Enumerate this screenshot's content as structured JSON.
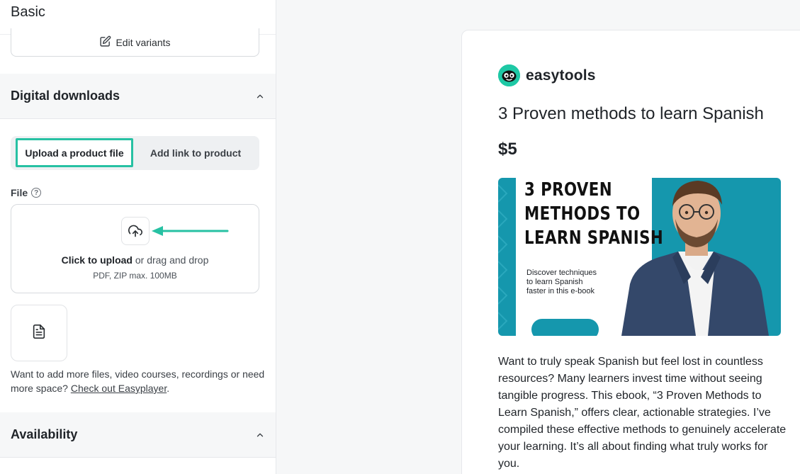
{
  "left": {
    "basic_title": "Basic",
    "edit_variants_label": "Edit variants",
    "digital_downloads_title": "Digital downloads",
    "tabs": {
      "upload": "Upload a product file",
      "link": "Add link to product"
    },
    "file_label": "File",
    "help_glyph": "?",
    "dropzone": {
      "click_text": "Click to upload",
      "rest_text": " or drag and drop",
      "formats": "PDF, ZIP max. 100MB"
    },
    "more_text": "Want to add more files, video courses, recordings or need more space? ",
    "more_link": "Check out Easyplayer",
    "more_end": ".",
    "availability_title": "Availability"
  },
  "preview": {
    "brand_name": "easytools",
    "product_title": "3 Proven methods to learn Spanish",
    "price": "$5",
    "cover": {
      "headline_1": "3 PROVEN",
      "headline_2": "METHODS TO",
      "headline_3": "LEARN SPANISH",
      "sub_1": "Discover techniques",
      "sub_2": "to learn Spanish",
      "sub_3": "faster in this e-book"
    },
    "description": "Want to truly speak Spanish but feel lost in countless resources? Many learners invest time without seeing tangible progress. This ebook, “3 Proven Methods to Learn Spanish,” offers clear, actionable strategies. I’ve compiled these effective methods to genuinely accelerate your learning. It’s all about finding what truly works for you."
  },
  "icons": [
    "edit-icon",
    "chevron-up-icon",
    "help-icon",
    "upload-cloud-icon",
    "arrow-left-icon",
    "file-icon",
    "easytools-logo"
  ],
  "colors": {
    "accent": "#27c1a3",
    "cover_teal": "#1597ad",
    "panel_bg": "#f6f7f8"
  }
}
